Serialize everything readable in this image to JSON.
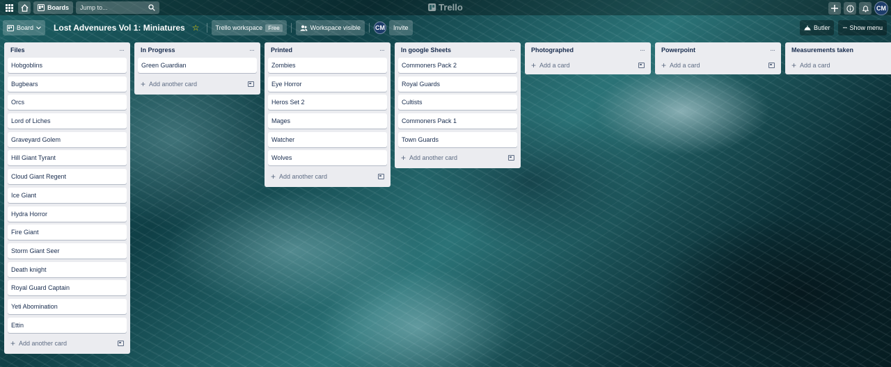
{
  "topbar": {
    "boards_label": "Boards",
    "search_placeholder": "Jump to...",
    "logo": "Trello",
    "avatar_initials": "CM"
  },
  "board": {
    "view_label": "Board",
    "title": "Lost Advenures Vol 1: Miniatures",
    "workspace_label": "Trello workspace",
    "workspace_badge": "Free",
    "visibility_label": "Workspace visible",
    "member_initials": "CM",
    "invite_label": "Invite",
    "butler_label": "Butler",
    "menu_label": "Show menu"
  },
  "lists": [
    {
      "title": "Files",
      "cards": [
        "Hobgoblins",
        "Bugbears",
        "Orcs",
        "Lord of Liches",
        "Graveyard Golem",
        "Hill Giant Tyrant",
        "Cloud Giant Regent",
        "Ice Giant",
        "Hydra Horror",
        "Fire Giant",
        "Storm Giant Seer",
        "Death knight",
        "Royal Guard Captain",
        "Yeti Abomination",
        "Ettin"
      ],
      "add_label": "Add another card"
    },
    {
      "title": "In Progress",
      "cards": [
        "Green Guardian"
      ],
      "add_label": "Add another card"
    },
    {
      "title": "Printed",
      "cards": [
        "Zombies",
        "Eye Horror",
        "Heros Set 2",
        "Mages",
        "Watcher",
        "Wolves"
      ],
      "add_label": "Add another card"
    },
    {
      "title": "In google Sheets",
      "cards": [
        "Commoners Pack 2",
        "Royal Guards",
        "Cultists",
        "Commoners Pack 1",
        "Town Guards"
      ],
      "add_label": "Add another card"
    },
    {
      "title": "Photographed",
      "cards": [],
      "add_label": "Add a card"
    },
    {
      "title": "Powerpoint",
      "cards": [],
      "add_label": "Add a card"
    },
    {
      "title": "Measurements taken",
      "cards": [],
      "add_label": "Add a card"
    }
  ]
}
